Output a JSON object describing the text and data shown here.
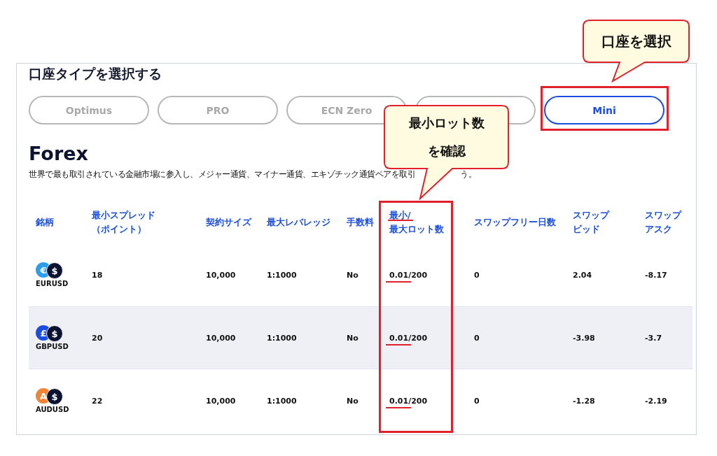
{
  "heading": "口座タイプを選択する",
  "account_tabs": [
    {
      "label": "Optimus",
      "selected": false
    },
    {
      "label": "PRO",
      "selected": false
    },
    {
      "label": "ECN Zero",
      "selected": false
    },
    {
      "selected": false
    },
    {
      "label": "Mini",
      "selected": true
    }
  ],
  "section_title": "Forex",
  "description": "世界で最も取引されている金融市場に参入し、メジャー通貨、マイナー通貨、エキゾチック通貨ペアを取引",
  "description_tail": "う。",
  "table": {
    "columns": [
      {
        "lines": [
          "銘柄"
        ]
      },
      {
        "lines": [
          "最小スプレッド",
          "（ポイント）"
        ]
      },
      {
        "lines": [
          "契約サイズ"
        ]
      },
      {
        "lines": [
          "最大レバレッジ"
        ]
      },
      {
        "lines": [
          "手数料"
        ]
      },
      {
        "lines": [
          "最小/",
          "最大ロット数"
        ],
        "underlined": true
      },
      {
        "lines": [
          "スワップフリー日数"
        ]
      },
      {
        "lines": [
          "スワップ",
          "ビッド"
        ]
      },
      {
        "lines": [
          "スワップ",
          "アスク"
        ]
      }
    ],
    "rows": [
      {
        "base_symbol": "€",
        "color": "#2b9ef0",
        "quote_symbol": "$",
        "symbol": "EURUSD",
        "values": [
          "18",
          "10,000",
          "1:1000",
          "No",
          "0.01/200",
          "0",
          "2.04",
          "-8.17"
        ],
        "lot_underlined": true
      },
      {
        "base_symbol": "£",
        "color": "#1a4ee0",
        "quote_symbol": "$",
        "symbol": "GBPUSD",
        "values": [
          "20",
          "10,000",
          "1:1000",
          "No",
          "0.01/200",
          "0",
          "-3.98",
          "-3.7"
        ],
        "lot_underlined": true
      },
      {
        "base_symbol": "A",
        "color": "#f08434",
        "quote_symbol": "$",
        "symbol": "AUDUSD",
        "values": [
          "22",
          "10,000",
          "1:1000",
          "No",
          "0.01/200",
          "0",
          "-1.28",
          "-2.19"
        ],
        "lot_underlined": true
      }
    ]
  },
  "annotations": [
    {
      "lines": [
        "口座を選択"
      ]
    },
    {
      "lines": [
        "最小ロット数",
        "を確認"
      ]
    }
  ]
}
